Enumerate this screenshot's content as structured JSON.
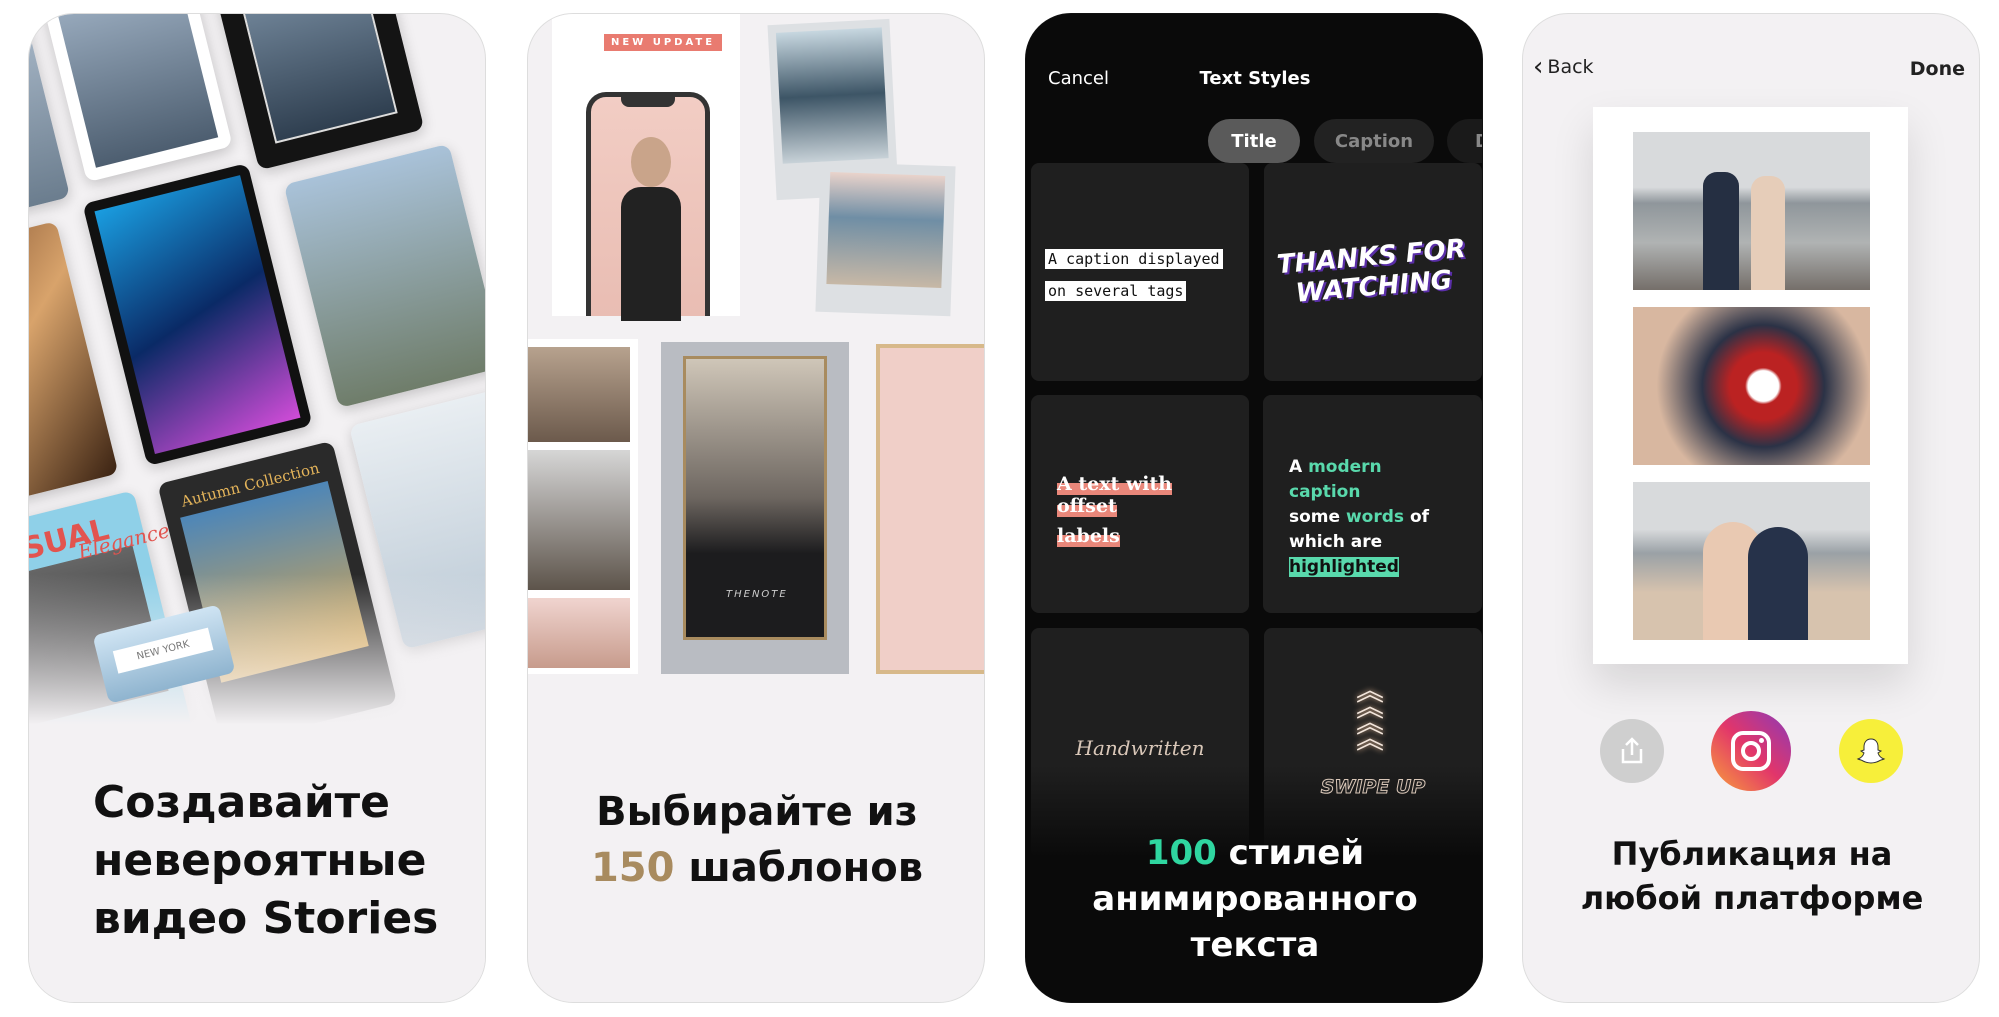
{
  "panels": [
    {
      "caption_lines": [
        "Создавайте",
        "невероятные",
        "видео Stories"
      ],
      "template_texts": {
        "casual": "CASUAL",
        "elegance": "Elegance",
        "autumn": "Autumn Collection",
        "new_york": "NEW YORK"
      }
    },
    {
      "badge": "NEW UPDATE",
      "phone_text": "THENOTE",
      "caption_line1": "Выбирайте из",
      "caption_number": "150",
      "caption_line2_rest": " шаблонов",
      "accent_color": "#a88b5f"
    },
    {
      "cancel": "Cancel",
      "title": "Text Styles",
      "tabs": [
        {
          "label": "Title",
          "selected": true
        },
        {
          "label": "Caption",
          "selected": false
        },
        {
          "label": "D",
          "selected": false
        }
      ],
      "tiles": {
        "caption_tags": [
          "A caption displayed",
          "on several tags"
        ],
        "thanks": [
          "THANKS FOR",
          "WATCHING"
        ],
        "offset": [
          "A text with offset",
          "labels"
        ],
        "modern": {
          "a": "A ",
          "g1": "modern caption",
          "l2a": "some ",
          "g2": "words",
          "l2b": " of",
          "l3": "which are",
          "hl": "highlighted"
        },
        "handwritten": "Handwritten",
        "swipe": "SWIPE UP"
      },
      "caption_number": "100",
      "caption_line1_rest": " стилей",
      "caption_line2": "анимированного текста",
      "accent_color": "#2fd6a0"
    },
    {
      "back": "Back",
      "done": "Done",
      "share_buttons": [
        {
          "icon": "share-icon"
        },
        {
          "icon": "instagram-icon"
        },
        {
          "icon": "snapchat-icon"
        }
      ],
      "caption_lines": [
        "Публикация на",
        "любой платформе"
      ]
    }
  ]
}
